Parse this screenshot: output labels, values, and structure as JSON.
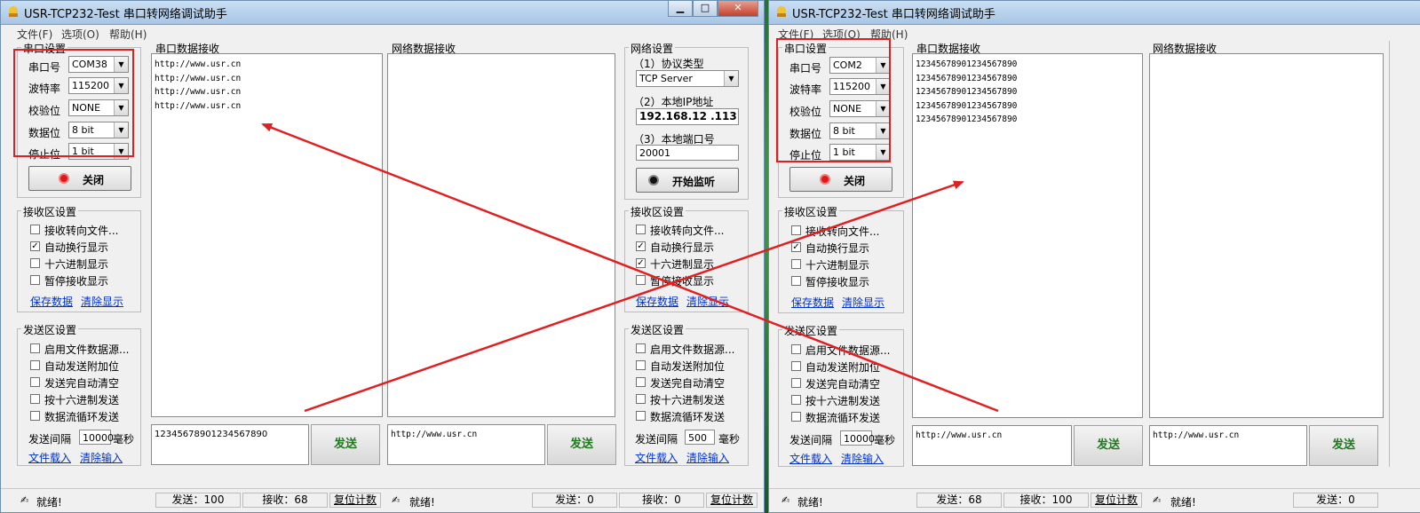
{
  "colors": {
    "titlebar": "#b8d2ee",
    "arrow": "#e02020",
    "link": "#0033cc",
    "send_text": "#207a20"
  },
  "left": {
    "title": "USR-TCP232-Test 串口转网络调试助手",
    "menu": [
      "文件(F)",
      "选项(O)",
      "帮助(H)"
    ],
    "serial_settings": {
      "title": "串口设置",
      "rows": [
        {
          "label": "串口号",
          "value": "COM38"
        },
        {
          "label": "波特率",
          "value": "115200"
        },
        {
          "label": "校验位",
          "value": "NONE"
        },
        {
          "label": "数据位",
          "value": "8 bit"
        },
        {
          "label": "停止位",
          "value": "1 bit"
        }
      ],
      "toggle_label": "关闭"
    },
    "serial_recv": {
      "title": "串口数据接收",
      "lines": [
        "http://www.usr.cn",
        "http://www.usr.cn",
        "http://www.usr.cn",
        "http://www.usr.cn"
      ]
    },
    "net_recv": {
      "title": "网络数据接收",
      "lines": []
    },
    "recv_settings": {
      "title": "接收区设置",
      "options": [
        {
          "label": "接收转向文件...",
          "checked": false
        },
        {
          "label": "自动换行显示",
          "checked": true
        },
        {
          "label": "十六进制显示",
          "checked": false
        },
        {
          "label": "暂停接收显示",
          "checked": false
        }
      ],
      "links": [
        "保存数据",
        "清除显示"
      ]
    },
    "send_settings": {
      "title": "发送区设置",
      "options": [
        {
          "label": "启用文件数据源...",
          "checked": false
        },
        {
          "label": "自动发送附加位",
          "checked": false
        },
        {
          "label": "发送完自动清空",
          "checked": false
        },
        {
          "label": "按十六进制发送",
          "checked": false
        },
        {
          "label": "数据流循环发送",
          "checked": false
        }
      ],
      "interval_label": "发送间隔",
      "interval_value": "10000",
      "interval_unit": "毫秒",
      "links": [
        "文件载入",
        "清除输入"
      ]
    },
    "serial_send": {
      "text": "12345678901234567890",
      "button": "发送"
    },
    "net_settings": {
      "title": "网络设置",
      "protocol_label": "（1）协议类型",
      "protocol_value": "TCP Server",
      "ip_label": "（2）本地IP地址",
      "ip_value": "192.168.12 .113",
      "port_label": "（3）本地端口号",
      "port_value": "20001",
      "listen_button": "开始监听"
    },
    "net_recv_settings": {
      "title": "接收区设置",
      "options": [
        {
          "label": "接收转向文件...",
          "checked": false
        },
        {
          "label": "自动换行显示",
          "checked": true
        },
        {
          "label": "十六进制显示",
          "checked": true
        },
        {
          "label": "暂停接收显示",
          "checked": false
        }
      ],
      "links": [
        "保存数据",
        "清除显示"
      ]
    },
    "net_send_settings": {
      "title": "发送区设置",
      "options": [
        {
          "label": "启用文件数据源...",
          "checked": false
        },
        {
          "label": "自动发送附加位",
          "checked": false
        },
        {
          "label": "发送完自动清空",
          "checked": false
        },
        {
          "label": "按十六进制发送",
          "checked": false
        },
        {
          "label": "数据流循环发送",
          "checked": false
        }
      ],
      "interval_label": "发送间隔",
      "interval_value": "500",
      "interval_unit": "毫秒",
      "links": [
        "文件载入",
        "清除输入"
      ]
    },
    "net_send": {
      "text": "http://www.usr.cn",
      "button": "发送"
    },
    "status": {
      "ready": "就绪!",
      "serial_send": "发送：100",
      "serial_recv": "接收：68",
      "reset": "复位计数",
      "ready2": "就绪!",
      "net_send": "发送：0",
      "net_recv": "接收：0",
      "reset2": "复位计数"
    }
  },
  "right": {
    "title": "USR-TCP232-Test 串口转网络调试助手",
    "menu": [
      "文件(F)",
      "选项(O)",
      "帮助(H)"
    ],
    "serial_settings": {
      "title": "串口设置",
      "rows": [
        {
          "label": "串口号",
          "value": "COM2"
        },
        {
          "label": "波特率",
          "value": "115200"
        },
        {
          "label": "校验位",
          "value": "NONE"
        },
        {
          "label": "数据位",
          "value": "8 bit"
        },
        {
          "label": "停止位",
          "value": "1 bit"
        }
      ],
      "toggle_label": "关闭"
    },
    "serial_recv": {
      "title": "串口数据接收",
      "lines": [
        "12345678901234567890",
        "12345678901234567890",
        "12345678901234567890",
        "12345678901234567890",
        "12345678901234567890"
      ]
    },
    "net_recv": {
      "title": "网络数据接收",
      "lines": []
    },
    "recv_settings": {
      "title": "接收区设置",
      "options": [
        {
          "label": "接收转向文件...",
          "checked": false
        },
        {
          "label": "自动换行显示",
          "checked": true
        },
        {
          "label": "十六进制显示",
          "checked": false
        },
        {
          "label": "暂停接收显示",
          "checked": false
        }
      ],
      "links": [
        "保存数据",
        "清除显示"
      ]
    },
    "send_settings": {
      "title": "发送区设置",
      "options": [
        {
          "label": "启用文件数据源...",
          "checked": false
        },
        {
          "label": "自动发送附加位",
          "checked": false
        },
        {
          "label": "发送完自动清空",
          "checked": false
        },
        {
          "label": "按十六进制发送",
          "checked": false
        },
        {
          "label": "数据流循环发送",
          "checked": false
        }
      ],
      "interval_label": "发送间隔",
      "interval_value": "10000",
      "interval_unit": "毫秒",
      "links": [
        "文件载入",
        "清除输入"
      ]
    },
    "serial_send": {
      "text": "http://www.usr.cn",
      "button": "发送"
    },
    "net_send": {
      "text": "http://www.usr.cn",
      "button": "发送"
    },
    "status": {
      "ready": "就绪!",
      "serial_send": "发送：68",
      "serial_recv": "接收：100",
      "reset": "复位计数",
      "ready2": "就绪!",
      "net_send": "发送：0"
    }
  }
}
